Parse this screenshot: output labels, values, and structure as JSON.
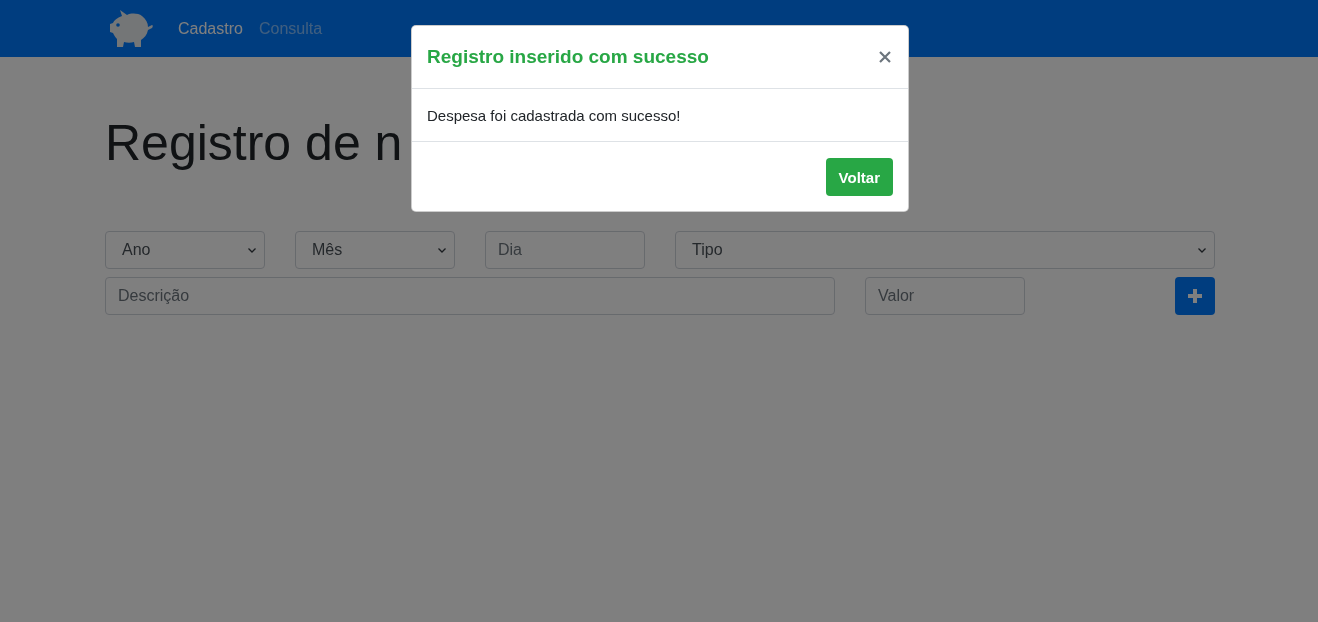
{
  "navbar": {
    "links": [
      {
        "label": "Cadastro",
        "selected": true
      },
      {
        "label": "Consulta",
        "selected": false
      }
    ]
  },
  "heading": "Registro de n",
  "form": {
    "rows": [
      [
        {
          "kind": "select",
          "placeholder": "Ano"
        },
        {
          "kind": "select",
          "placeholder": "Mês"
        },
        {
          "kind": "input",
          "placeholder": "Dia"
        },
        {
          "kind": "select",
          "placeholder": "Tipo"
        }
      ],
      [
        {
          "kind": "input",
          "placeholder": "Descrição"
        },
        {
          "kind": "input",
          "placeholder": "Valor"
        },
        {
          "kind": "add_button"
        }
      ]
    ]
  },
  "modal": {
    "title": "Registro inserido com sucesso",
    "message": "Despesa foi cadastrada com sucesso!",
    "button": "Voltar"
  }
}
